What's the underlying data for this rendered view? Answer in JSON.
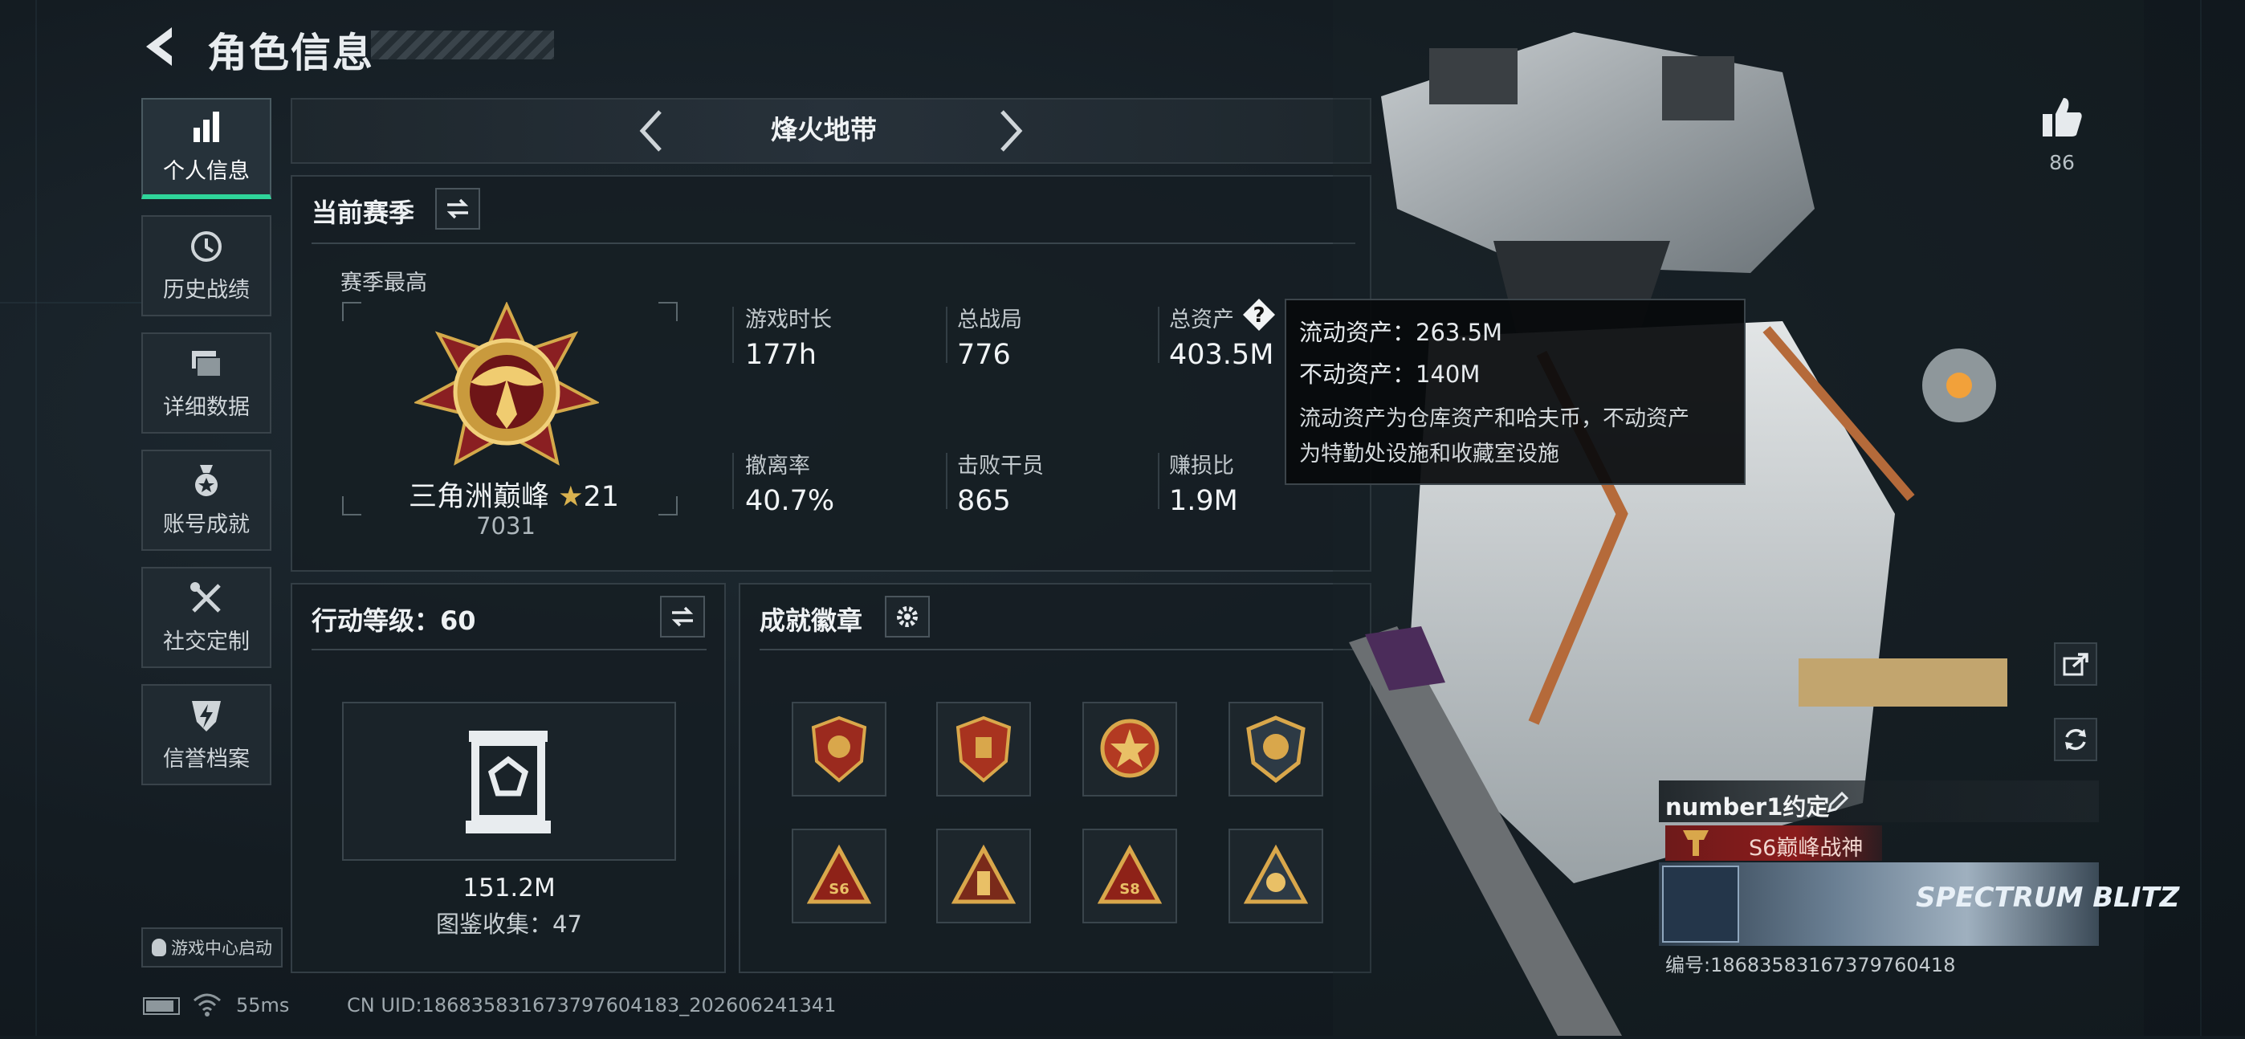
{
  "header": {
    "title": "角色信息"
  },
  "nav": [
    {
      "label": "个人信息",
      "icon": "bar-chart-icon",
      "active": true
    },
    {
      "label": "历史战绩",
      "icon": "history-clock-icon",
      "active": false
    },
    {
      "label": "详细数据",
      "icon": "folder-stack-icon",
      "active": false
    },
    {
      "label": "账号成就",
      "icon": "medal-star-icon",
      "active": false
    },
    {
      "label": "社交定制",
      "icon": "tools-icon",
      "active": false
    },
    {
      "label": "信誉档案",
      "icon": "shield-bolt-icon",
      "active": false
    }
  ],
  "game_center_button": "游戏中心启动",
  "mode_selector": {
    "label": "烽火地带"
  },
  "current_season": {
    "title": "当前赛季",
    "season_best_label": "赛季最高",
    "rank_name": "三角洲巅峰",
    "rank_stars": "21",
    "rank_points": "7031",
    "stats": [
      {
        "label": "游戏时长",
        "value": "177h"
      },
      {
        "label": "总战局",
        "value": "776"
      },
      {
        "label": "总资产",
        "value": "403.5M"
      },
      {
        "label": "撤离率",
        "value": "40.7%"
      },
      {
        "label": "击败干员",
        "value": "865"
      },
      {
        "label": "赚损比",
        "value": "1.9M"
      }
    ]
  },
  "tooltip": {
    "liquid": "流动资产：263.5M",
    "fixed": "不动资产：140M",
    "desc_line1": "流动资产为仓库资产和哈夫币，不动资产",
    "desc_line2": "为特勤处设施和收藏室设施"
  },
  "action_level": {
    "title": "行动等级：60",
    "collection_value": "151.2M",
    "collection_count": "图鉴收集：47"
  },
  "achievements": {
    "title": "成就徽章",
    "badges": [
      "shield-red-badge",
      "shield-red-badge-2",
      "star-emblem-badge",
      "skull-shield-badge",
      "s6-triangle-badge",
      "tower-triangle-badge",
      "s8-triangle-badge",
      "skull-triangle-badge"
    ]
  },
  "likes": {
    "count": "86"
  },
  "player": {
    "name": "number1约定",
    "title": "S6巅峰战神",
    "card_text": "SPECTRUM BLITZ",
    "id_line": "编号:18683583167379760418"
  },
  "status_bar": {
    "ping": "55ms",
    "uid": "CN UID:18683583167379760418​3_202606241341"
  },
  "colors": {
    "accent_green": "#2fd59a",
    "title_red": "#8b1c1c"
  }
}
